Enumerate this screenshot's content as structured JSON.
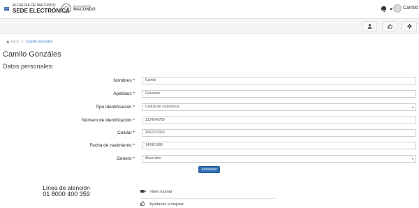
{
  "header": {
    "brand_small": "ALCALDÍA DE MACONDO",
    "brand_big": "SEDE ELECTRÓNICA",
    "logo_small": "ALCALDÍA DE",
    "logo_big": "MACONDO",
    "user_name": "Camilo"
  },
  "breadcrumb": {
    "home": "Inicio",
    "current": "Camilo Gonzáles"
  },
  "page": {
    "title": "Camilo Gonzáles",
    "section": "Datos personales:"
  },
  "form": {
    "fields": [
      {
        "label": "Nombres *",
        "value": "Camilo"
      },
      {
        "label": "Apellidos *",
        "value": "Gonzáles"
      },
      {
        "label": "Tipo identificación *",
        "value": "Cédula de ciudadanía"
      },
      {
        "label": "Número de identificación *",
        "value": "1234546789"
      },
      {
        "label": "Celular *",
        "value": "3002223333"
      },
      {
        "label": "Fecha de nacimiento *",
        "value": "14/06/1999"
      },
      {
        "label": "Género *",
        "value": "Masculino"
      }
    ],
    "submit_label": "Actualizar"
  },
  "footer": {
    "line_title": "Línea de atención",
    "line_number": "01 8000 400 359",
    "video_link": "Video tutorial",
    "help_link": "Ayúdanos a mejorar"
  },
  "icons": {
    "user": "user-icon",
    "like": "thumbs-up-icon",
    "settings": "gear-icon"
  }
}
